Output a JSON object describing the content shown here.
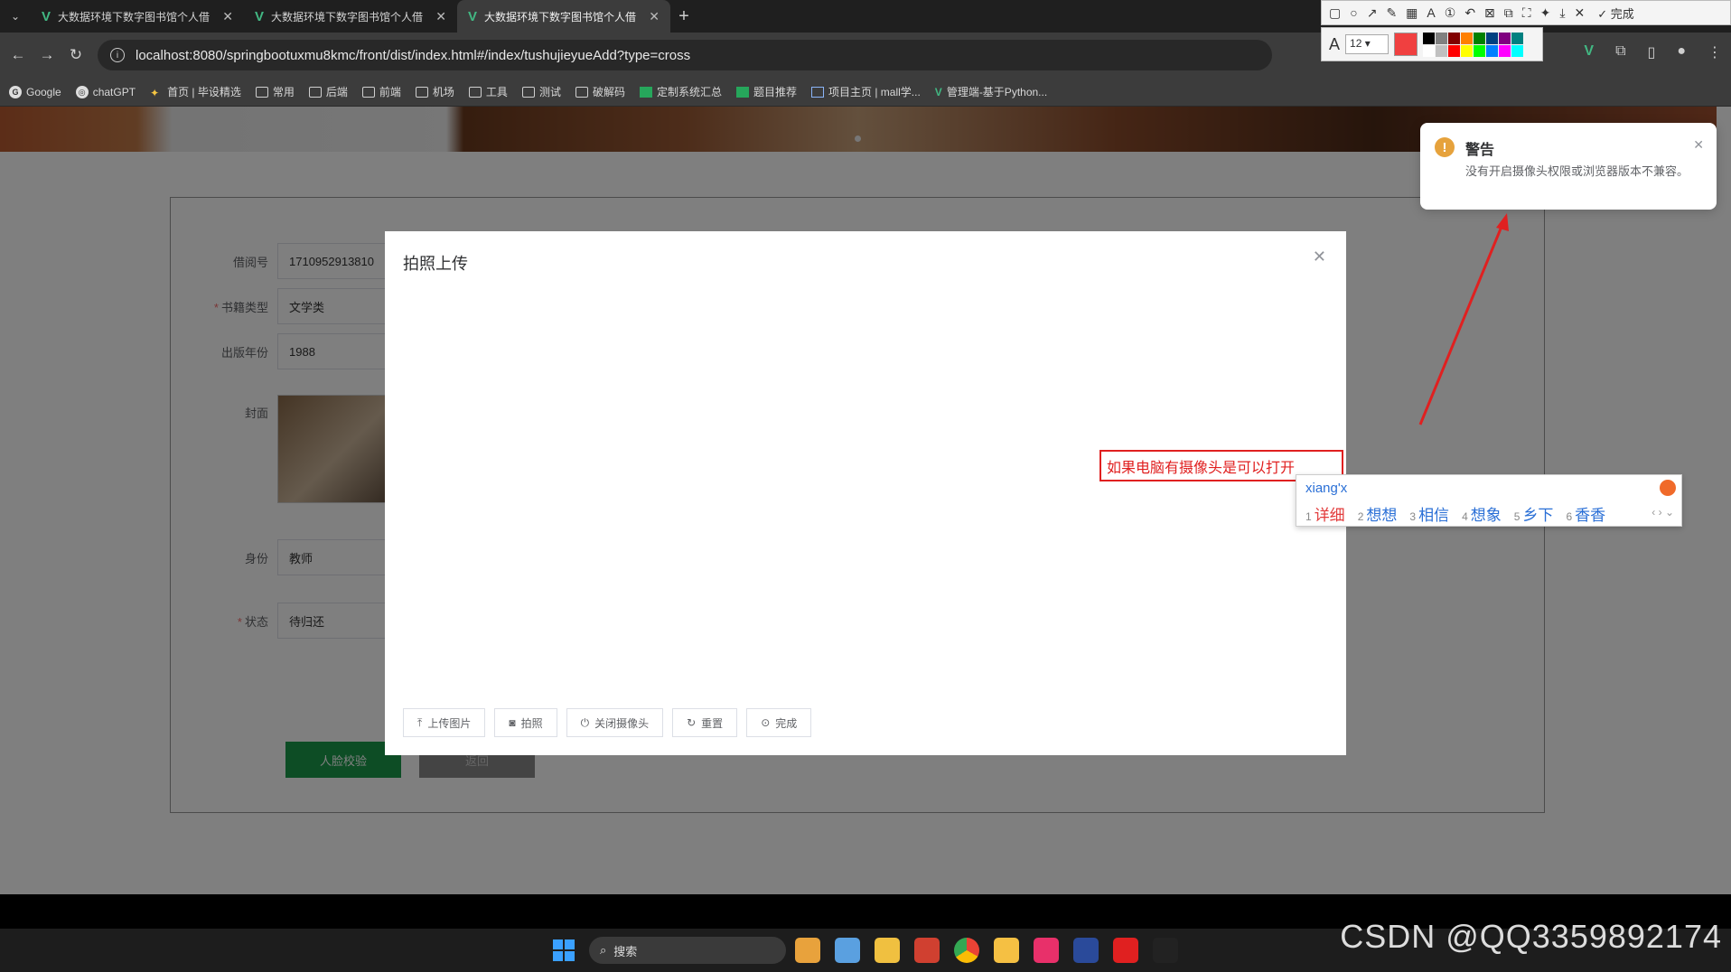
{
  "browser": {
    "tabs": [
      {
        "title": "大数据环境下数字图书馆个人借"
      },
      {
        "title": "大数据环境下数字图书馆个人借"
      },
      {
        "title": "大数据环境下数字图书馆个人借"
      }
    ],
    "url": "localhost:8080/springbootuxmu8kmc/front/dist/index.html#/index/tushujieyueAdd?type=cross",
    "bookmarks": [
      {
        "label": "Google",
        "icon": "google-icon"
      },
      {
        "label": "chatGPT",
        "icon": "chatgpt-icon"
      },
      {
        "label": "首页 | 毕设精选",
        "icon": "site-icon"
      },
      {
        "label": "常用",
        "icon": "folder-icon"
      },
      {
        "label": "后端",
        "icon": "folder-icon"
      },
      {
        "label": "前端",
        "icon": "folder-icon"
      },
      {
        "label": "机场",
        "icon": "folder-icon"
      },
      {
        "label": "工具",
        "icon": "folder-icon"
      },
      {
        "label": "测试",
        "icon": "folder-icon"
      },
      {
        "label": "破解码",
        "icon": "folder-icon"
      },
      {
        "label": "定制系统汇总",
        "icon": "sheet-icon"
      },
      {
        "label": "题目推荐",
        "icon": "sheet-icon"
      },
      {
        "label": "项目主页 | mall学...",
        "icon": "page-icon"
      },
      {
        "label": "管理端-基于Python...",
        "icon": "vue-icon"
      }
    ]
  },
  "annotation_toolbar": {
    "done_label": "完成",
    "font_size": "12",
    "current_color": "#f04040",
    "palette": [
      "#000000",
      "#808080",
      "#800000",
      "#ff8000",
      "#008000",
      "#004080",
      "#800080",
      "#008080",
      "#ffffff",
      "#c0c0c0",
      "#ff0000",
      "#ffff00",
      "#00ff00",
      "#0080ff",
      "#ff00ff",
      "#00ffff"
    ]
  },
  "form": {
    "fields": [
      {
        "label": "借阅号",
        "required": false,
        "value": "1710952913810"
      },
      {
        "label": "书籍类型",
        "required": true,
        "value": "文学类"
      },
      {
        "label": "出版年份",
        "required": false,
        "value": "1988"
      },
      {
        "label": "封面",
        "required": false,
        "value": ""
      },
      {
        "label": "身份",
        "required": false,
        "value": "教师"
      },
      {
        "label": "状态",
        "required": true,
        "value": "待归还"
      }
    ],
    "face_button": "人脸校验",
    "back_button": "返回"
  },
  "dialog": {
    "title": "拍照上传",
    "buttons": [
      {
        "label": "上传图片",
        "icon": "upload-icon"
      },
      {
        "label": "拍照",
        "icon": "camera-icon"
      },
      {
        "label": "关闭摄像头",
        "icon": "power-icon"
      },
      {
        "label": "重置",
        "icon": "refresh-icon"
      },
      {
        "label": "完成",
        "icon": "check-circle-icon"
      }
    ]
  },
  "annotation_text": "如果电脑有摄像头是可以打开",
  "ime": {
    "input": "xiang'x",
    "candidates": [
      "详细",
      "想想",
      "相信",
      "想象",
      "乡下",
      "香香"
    ]
  },
  "notification": {
    "title": "警告",
    "message": "没有开启摄像头权限或浏览器版本不兼容。"
  },
  "taskbar": {
    "search_placeholder": "搜索"
  },
  "watermark": "CSDN @QQ3359892174"
}
